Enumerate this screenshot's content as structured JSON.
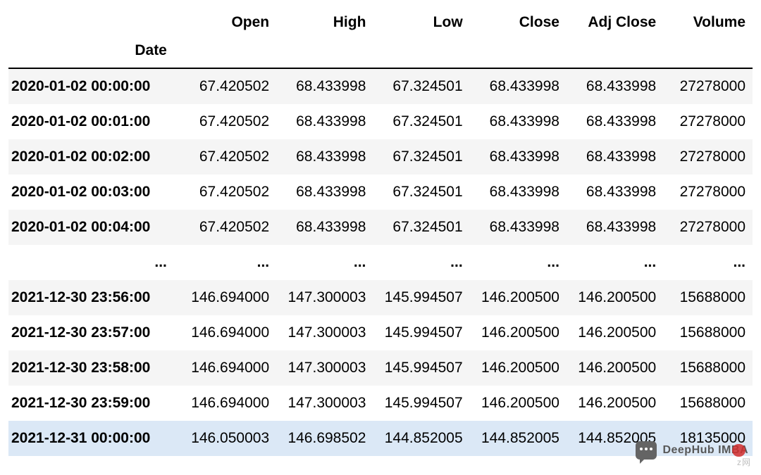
{
  "chart_data": {
    "type": "table",
    "index_name": "Date",
    "columns": [
      "Open",
      "High",
      "Low",
      "Close",
      "Adj Close",
      "Volume"
    ],
    "rows": [
      {
        "idx": "2020-01-02 00:00:00",
        "cells": [
          "67.420502",
          "68.433998",
          "67.324501",
          "68.433998",
          "68.433998",
          "27278000"
        ]
      },
      {
        "idx": "2020-01-02 00:01:00",
        "cells": [
          "67.420502",
          "68.433998",
          "67.324501",
          "68.433998",
          "68.433998",
          "27278000"
        ]
      },
      {
        "idx": "2020-01-02 00:02:00",
        "cells": [
          "67.420502",
          "68.433998",
          "67.324501",
          "68.433998",
          "68.433998",
          "27278000"
        ]
      },
      {
        "idx": "2020-01-02 00:03:00",
        "cells": [
          "67.420502",
          "68.433998",
          "67.324501",
          "68.433998",
          "68.433998",
          "27278000"
        ]
      },
      {
        "idx": "2020-01-02 00:04:00",
        "cells": [
          "67.420502",
          "68.433998",
          "67.324501",
          "68.433998",
          "68.433998",
          "27278000"
        ]
      },
      {
        "idx": "...",
        "cells": [
          "...",
          "...",
          "...",
          "...",
          "...",
          "..."
        ],
        "ellipsis": true
      },
      {
        "idx": "2021-12-30 23:56:00",
        "cells": [
          "146.694000",
          "147.300003",
          "145.994507",
          "146.200500",
          "146.200500",
          "15688000"
        ]
      },
      {
        "idx": "2021-12-30 23:57:00",
        "cells": [
          "146.694000",
          "147.300003",
          "145.994507",
          "146.200500",
          "146.200500",
          "15688000"
        ]
      },
      {
        "idx": "2021-12-30 23:58:00",
        "cells": [
          "146.694000",
          "147.300003",
          "145.994507",
          "146.200500",
          "146.200500",
          "15688000"
        ]
      },
      {
        "idx": "2021-12-30 23:59:00",
        "cells": [
          "146.694000",
          "147.300003",
          "145.994507",
          "146.200500",
          "146.200500",
          "15688000"
        ]
      },
      {
        "idx": "2021-12-31 00:00:00",
        "cells": [
          "146.050003",
          "146.698502",
          "144.852005",
          "144.852005",
          "144.852005",
          "18135000"
        ],
        "selected": true
      }
    ]
  },
  "watermark": {
    "text": "DeepHub IMBA"
  },
  "corner_text": "z网"
}
